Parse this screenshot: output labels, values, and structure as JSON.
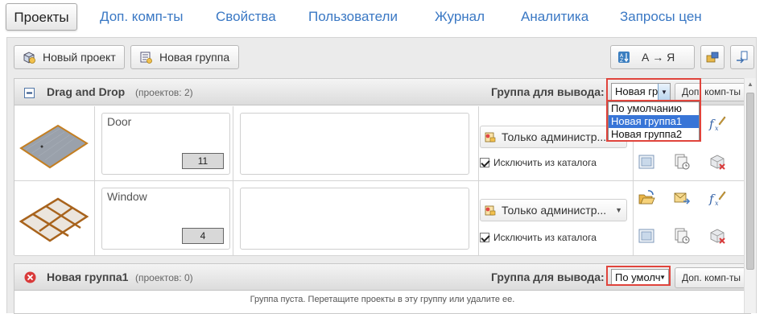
{
  "tabs": [
    {
      "label": "Проекты",
      "active": true
    },
    {
      "label": "Доп. комп-ты"
    },
    {
      "label": "Свойства"
    },
    {
      "label": "Пользователи"
    },
    {
      "label": "Журнал"
    },
    {
      "label": "Аналитика"
    },
    {
      "label": "Запросы цен"
    }
  ],
  "toolbar": {
    "new_project_label": "Новый проект",
    "new_group_label": "Новая группа",
    "sort_label": "А → Я"
  },
  "groups": [
    {
      "title": "Drag and Drop",
      "count": "(проектов: 2)",
      "output_label": "Группа для вывода:",
      "output_value": "Новая гр",
      "addon_button": "Доп. комп-ты",
      "dropdown_options": [
        "По умолчанию",
        "Новая группа1",
        "Новая группа2"
      ],
      "dropdown_selected": "Новая группа1",
      "projects": [
        {
          "name": "Door",
          "number": "11",
          "access": "Только администр...",
          "exclude_label": "Исключить из каталога"
        },
        {
          "name": "Window",
          "number": "4",
          "access": "Только администр...",
          "exclude_label": "Исключить из каталога"
        }
      ]
    },
    {
      "title": "Новая группа1",
      "count": "(проектов: 0)",
      "output_label": "Группа для вывода:",
      "output_value": "По умолч",
      "addon_button": "Доп. комп-ты",
      "empty_message": "Группа пуста. Перетащите проекты в эту группу или удалите ее."
    }
  ],
  "colors": {
    "tab_link": "#3a78c4",
    "highlight": "#e0443c",
    "selection": "#3875d7"
  }
}
